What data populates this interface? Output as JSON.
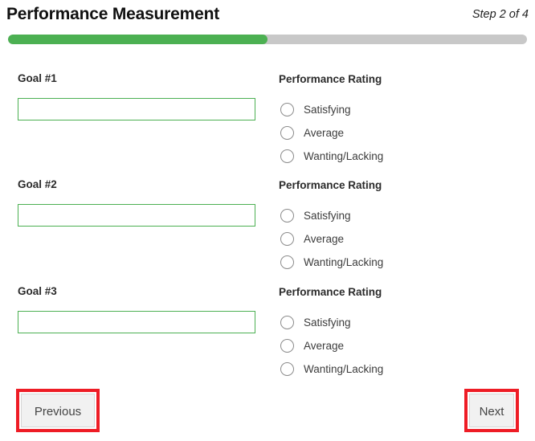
{
  "header": {
    "title": "Performance Measurement",
    "step_text": "Step 2 of 4"
  },
  "progress": {
    "percent": 50,
    "fill_color": "#4cb052",
    "track_color": "#c8c8c8"
  },
  "goals": [
    {
      "label": "Goal #1",
      "value": "",
      "placeholder": "",
      "rating_title": "Performance Rating",
      "options": [
        "Satisfying",
        "Average",
        "Wanting/Lacking"
      ]
    },
    {
      "label": "Goal #2",
      "value": "",
      "placeholder": "",
      "rating_title": "Performance Rating",
      "options": [
        "Satisfying",
        "Average",
        "Wanting/Lacking"
      ]
    },
    {
      "label": "Goal #3",
      "value": "",
      "placeholder": "",
      "rating_title": "Performance Rating",
      "options": [
        "Satisfying",
        "Average",
        "Wanting/Lacking"
      ]
    }
  ],
  "navigation": {
    "previous_label": "Previous",
    "next_label": "Next",
    "highlight_color": "#ee1c25"
  }
}
